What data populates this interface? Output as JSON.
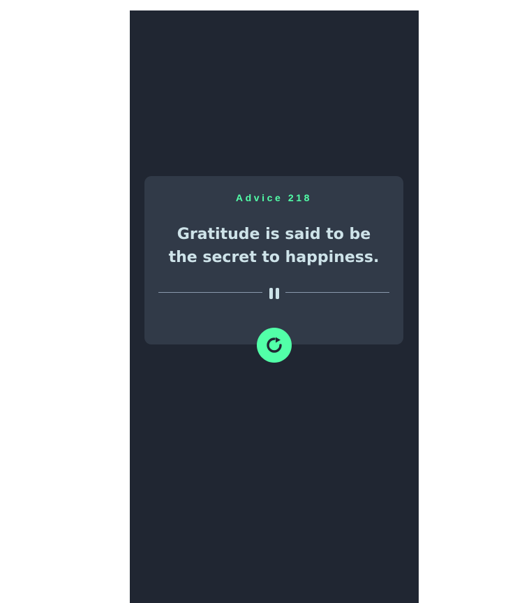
{
  "card": {
    "advice_label": "Advice 218",
    "quote": "Gratitude is said to be the secret to happiness."
  },
  "divider": {
    "icon": "pause-icon"
  },
  "action_button": {
    "icon": "refresh-icon"
  },
  "colors": {
    "page_background": "#ffffff",
    "viewport_background": "#202632",
    "card_background": "#313a48",
    "accent": "#52ffa8",
    "text": "#cee3e9"
  }
}
